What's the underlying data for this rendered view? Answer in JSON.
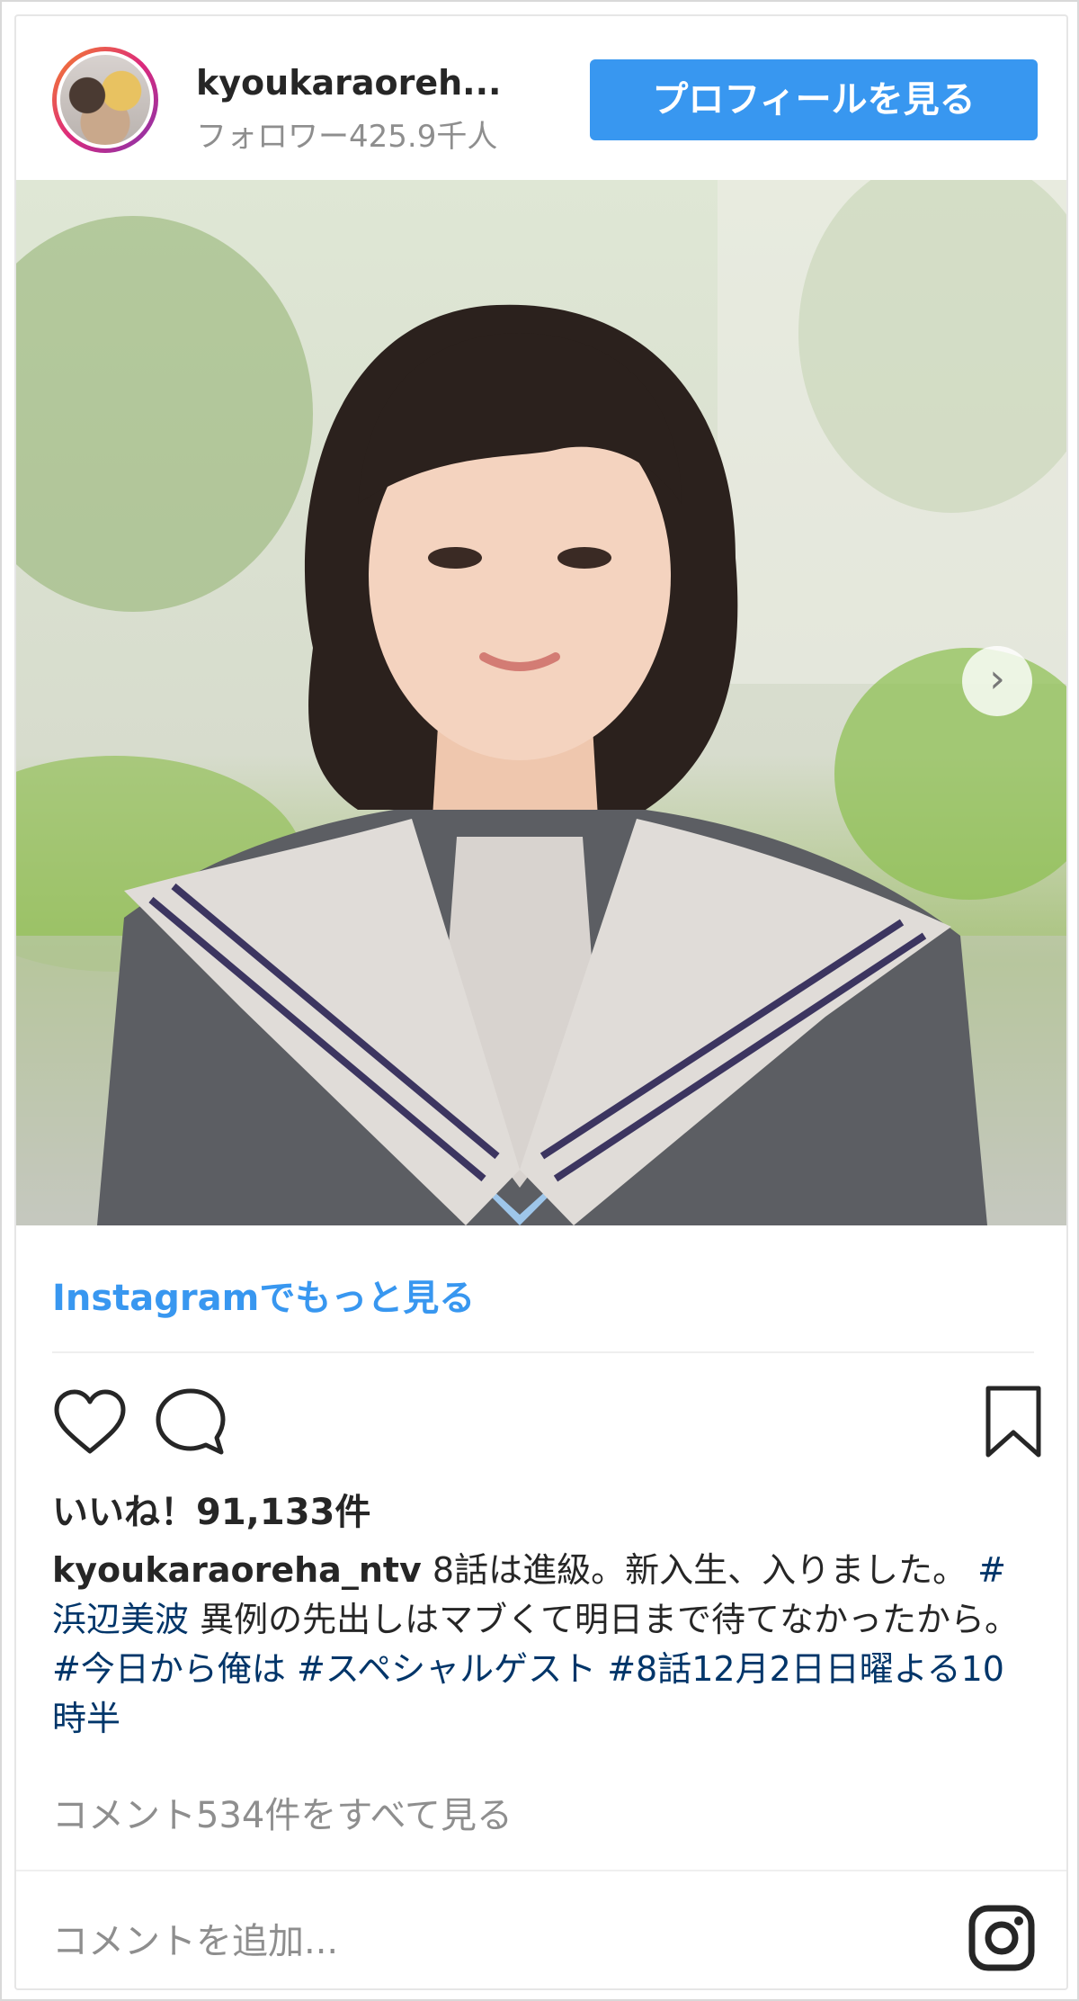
{
  "header": {
    "username": "kyoukaraoreh...",
    "followers": "フォロワー425.9千人",
    "profile_button": "プロフィールを見る"
  },
  "post": {
    "more_link": "Instagramでもっと見る",
    "likes": "いいね！91,133件",
    "caption": {
      "author": "kyoukaraoreha_ntv",
      "text_1": " 8話は進級。新入生、入りました。 ",
      "tag_1": "#浜辺美波",
      "text_2": " 異例の先出しはマブくて明日まで待てなかったから。",
      "tag_2": "#今日から俺は",
      "text_3": " ",
      "tag_3": "#スペシャルゲスト",
      "text_4": " ",
      "tag_4": "#8話12月2日日曜よる10時半"
    },
    "view_comments": "コメント534件をすべて見る",
    "add_comment_placeholder": "コメントを追加..."
  },
  "icons": {
    "like": "heart-icon",
    "comment": "comment-icon",
    "save": "bookmark-icon",
    "instagram": "instagram-icon",
    "next": "chevron-right-icon"
  },
  "colors": {
    "accent": "#3897f0",
    "hashtag": "#003569",
    "muted": "#8e8e8e"
  }
}
